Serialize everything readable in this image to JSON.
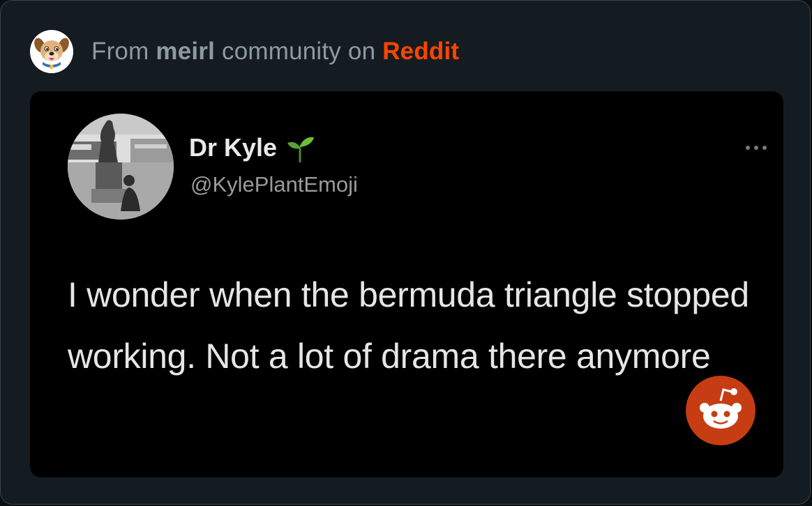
{
  "header": {
    "prefix": "From",
    "subreddit": "meirl",
    "middle": "community on",
    "platform": "Reddit",
    "platform_color": "#ff4500",
    "avatar_icon": "dog-mascot-icon"
  },
  "tweet": {
    "display_name": "Dr Kyle",
    "name_emoji": "seedling-icon",
    "handle": "@KylePlantEmoji",
    "text": "I wonder when the bermuda triangle stopped working. Not a lot of drama there anymore",
    "more_icon": "more-options-icon"
  },
  "overlay": {
    "badge_icon": "reddit-logo-icon",
    "badge_color": "#c63d13"
  }
}
